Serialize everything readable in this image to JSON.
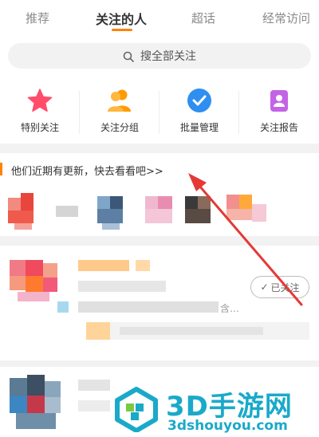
{
  "tabs": [
    {
      "label": "推荐",
      "active": false
    },
    {
      "label": "关注的人",
      "active": true
    },
    {
      "label": "超话",
      "active": false
    },
    {
      "label": "经常访问",
      "active": false
    }
  ],
  "search": {
    "label": "搜全部关注"
  },
  "functions": [
    {
      "label": "特别关注",
      "icon": "star-icon",
      "color": "#ff4d6a"
    },
    {
      "label": "关注分组",
      "icon": "group-icon",
      "color": "#ff9a00"
    },
    {
      "label": "批量管理",
      "icon": "check-circle-icon",
      "color": "#2f8ff0"
    },
    {
      "label": "关注报告",
      "icon": "report-icon",
      "color": "#c463e6"
    }
  ],
  "banner": {
    "text": "他们近期有更新，快去看看吧>>"
  },
  "card": {
    "follow_label": "已关注",
    "ellipsis": "含…"
  },
  "watermark": {
    "title": "3D手游网",
    "url": "3dshouyou.com"
  },
  "colors": {
    "accent": "#ff8200",
    "annotation": "#e53935",
    "watermark": "#1aa9c9"
  }
}
